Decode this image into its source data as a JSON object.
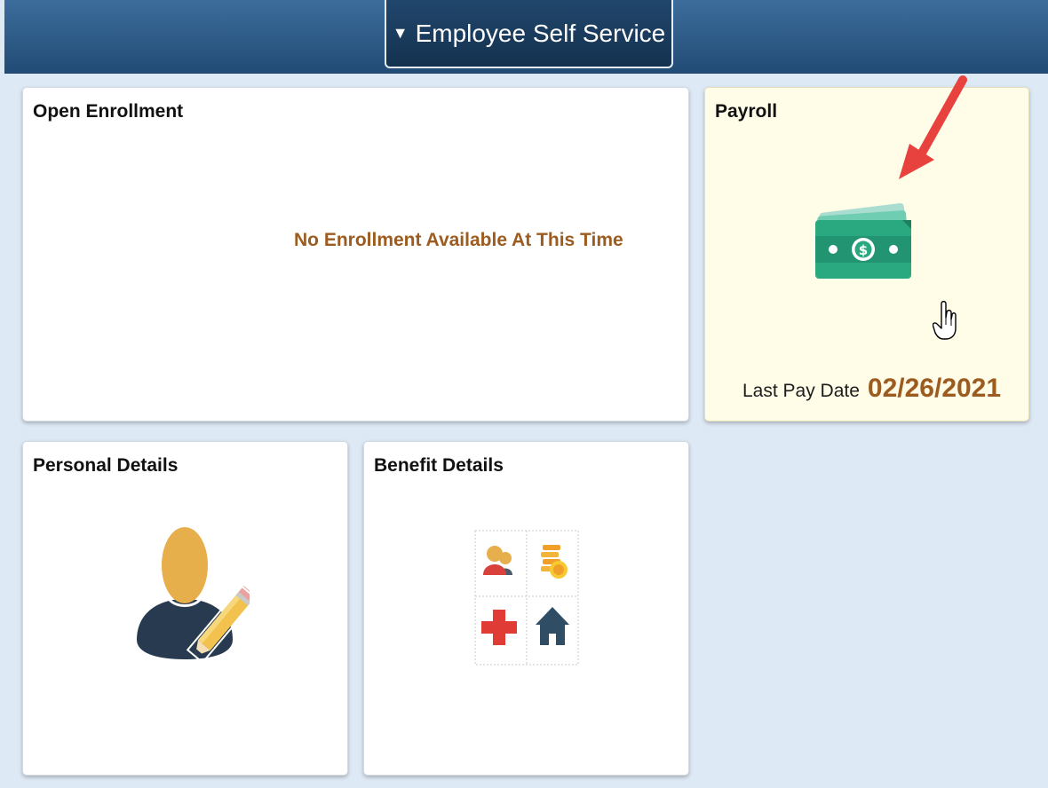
{
  "header": {
    "homepage_selector": "Employee Self Service",
    "caret_icon": "caret-down-icon"
  },
  "tiles": {
    "open_enrollment": {
      "title": "Open Enrollment",
      "message": "No Enrollment Available At This Time"
    },
    "payroll": {
      "title": "Payroll",
      "icon": "money-bill-icon",
      "last_pay_date_label": "Last Pay Date",
      "last_pay_date": "02/26/2021"
    },
    "personal_details": {
      "title": "Personal Details",
      "icon": "person-edit-icon"
    },
    "benefit_details": {
      "title": "Benefit Details",
      "icon": "benefits-grid-icon"
    }
  },
  "colors": {
    "header": "#214b75",
    "background": "#dde9f5",
    "accent_text": "#9c5b1f",
    "payroll_tile": "#fffce8",
    "annotation_arrow": "#e8423f"
  }
}
